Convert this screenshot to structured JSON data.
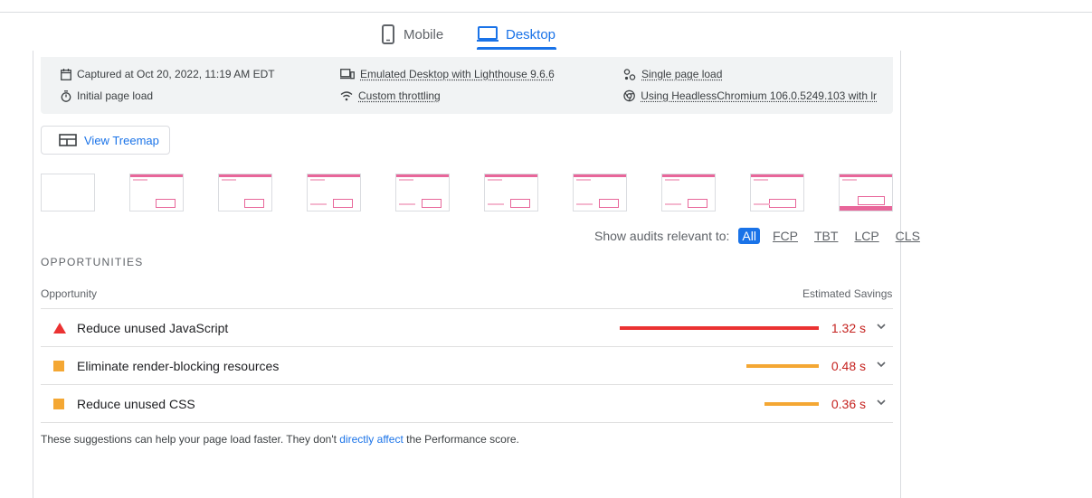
{
  "tabs": {
    "mobile_label": "Mobile",
    "desktop_label": "Desktop",
    "active": "Desktop"
  },
  "environment": {
    "captured": "Captured at Oct 20, 2022, 11:19 AM EDT",
    "initial_load": "Initial page load",
    "emulated": "Emulated Desktop with Lighthouse 9.6.6",
    "throttling": "Custom throttling",
    "session": "Single page load",
    "browser": "Using HeadlessChromium 106.0.5249.103 with lr"
  },
  "treemap_button": "View Treemap",
  "audit_filter": {
    "label": "Show audits relevant to:",
    "options": [
      "All",
      "FCP",
      "TBT",
      "LCP",
      "CLS"
    ],
    "selected": "All"
  },
  "opportunities": {
    "section_title": "OPPORTUNITIES",
    "col_opportunity": "Opportunity",
    "col_savings": "Estimated Savings",
    "items": [
      {
        "title": "Reduce unused JavaScript",
        "savings": "1.32 s",
        "severity": "fail",
        "color": "#eb3232",
        "bar_fraction": 1.0
      },
      {
        "title": "Eliminate render-blocking resources",
        "savings": "0.48 s",
        "severity": "average",
        "color": "#f4a733",
        "bar_fraction": 0.364
      },
      {
        "title": "Reduce unused CSS",
        "savings": "0.36 s",
        "severity": "average",
        "color": "#f4a733",
        "bar_fraction": 0.273
      }
    ]
  },
  "footnote": {
    "before": "These suggestions can help your page load faster. They don't ",
    "link": "directly affect",
    "after": " the Performance score."
  },
  "colors": {
    "accent": "#1a73e8",
    "fail": "#eb3232",
    "average": "#f4a733",
    "savings_text": "#c5221f"
  }
}
